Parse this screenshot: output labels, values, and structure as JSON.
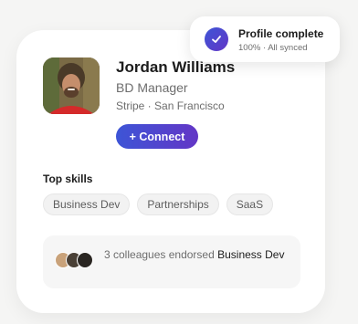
{
  "profile": {
    "name": "Jordan Williams",
    "role": "BD Manager",
    "location": "Stripe · San Francisco",
    "connect_label": "+ Connect"
  },
  "skills": {
    "title": "Top skills",
    "items": [
      "Business Dev",
      "Partnerships",
      "SaaS"
    ]
  },
  "endorsement": {
    "text_prefix": "3 colleagues endorsed ",
    "skill": "Business Dev"
  },
  "toast": {
    "title": "Profile complete",
    "subtitle": "100% · All synced",
    "icon": "check-icon"
  },
  "colors": {
    "accent_start": "#3d55d6",
    "accent_end": "#6336c6"
  }
}
